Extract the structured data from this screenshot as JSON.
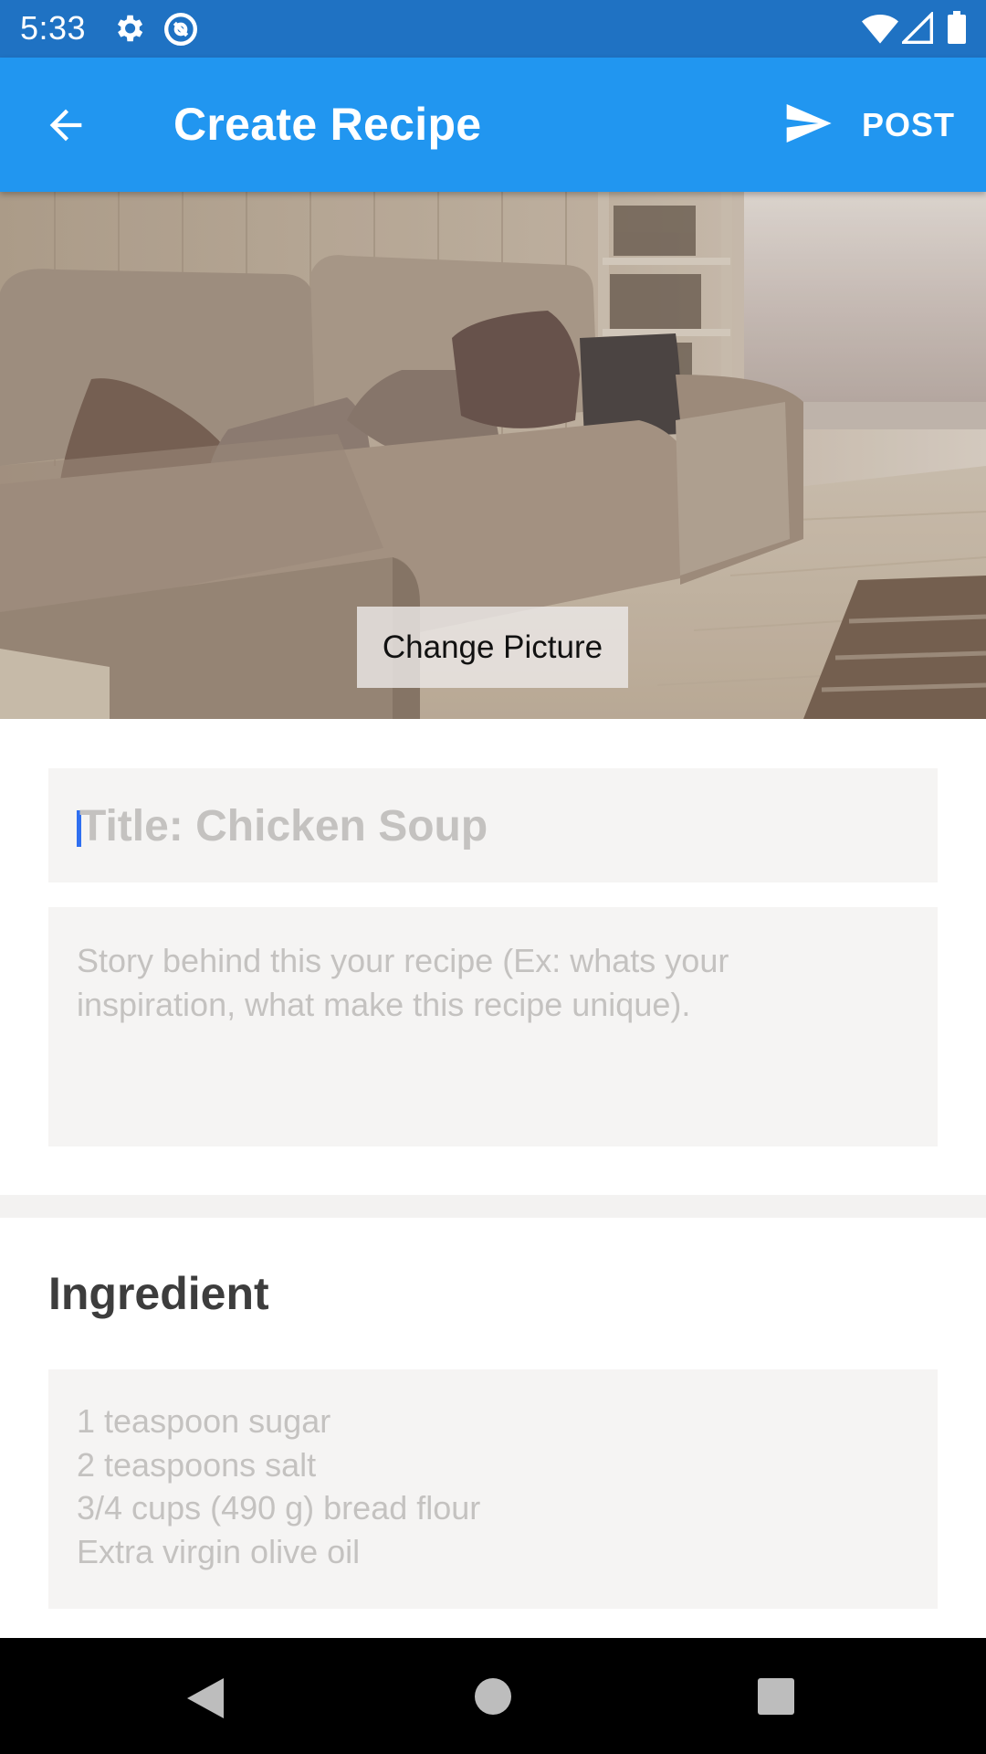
{
  "status_bar": {
    "time": "5:33",
    "icons": [
      "gear-icon",
      "at-sign-icon",
      "wifi-icon",
      "cell-signal-icon",
      "battery-icon"
    ]
  },
  "app_bar": {
    "title": "Create Recipe",
    "back_icon": "arrow-left-icon",
    "post_icon": "send-icon",
    "post_label": "POST",
    "background_color": "#2196f0"
  },
  "hero": {
    "change_picture_label": "Change Picture"
  },
  "form": {
    "title_placeholder": "Title: Chicken Soup",
    "story_placeholder": "Story behind this your recipe (Ex: whats your\ninspiration, what make this recipe unique).",
    "ingredient_heading": "Ingredient",
    "ingredient_placeholder": "1 teaspoon sugar\n2 teaspoons salt\n3/4 cups (490 g) bread flour\nExtra virgin olive oil"
  },
  "nav_bar": {
    "icons": [
      "back-triangle-icon",
      "home-circle-icon",
      "recents-square-icon"
    ]
  }
}
